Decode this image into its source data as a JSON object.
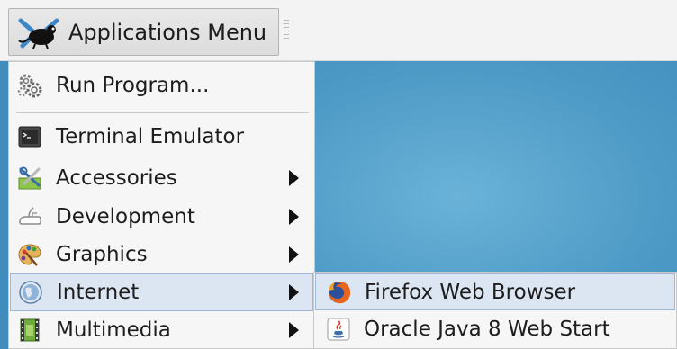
{
  "panel": {
    "app_menu_label": "Applications Menu"
  },
  "menu": {
    "items": [
      {
        "label": "Run Program...",
        "icon": "gears-icon"
      },
      {
        "label": "Terminal Emulator",
        "icon": "terminal-icon"
      },
      {
        "label": "Accessories",
        "icon": "accessories-icon",
        "has_submenu": true
      },
      {
        "label": "Development",
        "icon": "development-icon",
        "has_submenu": true
      },
      {
        "label": "Graphics",
        "icon": "graphics-palette-icon",
        "has_submenu": true
      },
      {
        "label": "Internet",
        "icon": "internet-globe-icon",
        "has_submenu": true,
        "active": true
      },
      {
        "label": "Multimedia",
        "icon": "multimedia-film-icon",
        "has_submenu": true
      }
    ]
  },
  "submenu": {
    "items": [
      {
        "label": "Firefox Web Browser",
        "icon": "firefox-icon",
        "active": true
      },
      {
        "label": "Oracle Java 8 Web Start",
        "icon": "java-icon"
      }
    ]
  },
  "colors": {
    "highlight_bg": "#dce6f2",
    "highlight_border": "#9fb7d6",
    "desktop_blue": "#4d9ac6",
    "menu_bg": "#f6f6f6"
  }
}
